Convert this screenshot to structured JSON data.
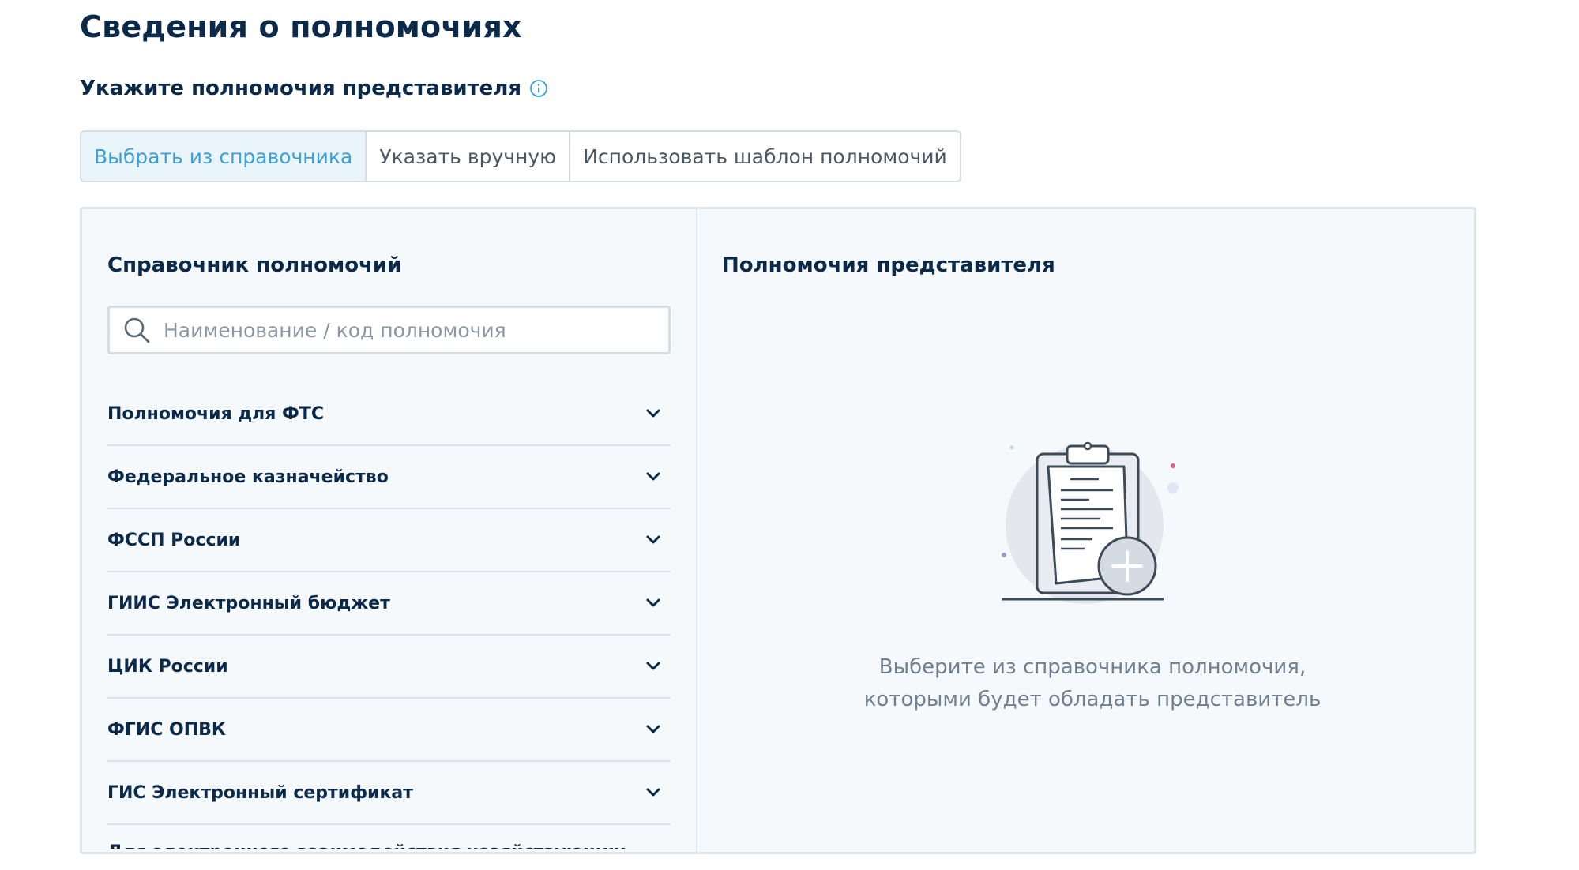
{
  "page": {
    "title": "Сведения о полномочиях",
    "subtitle": "Укажите полномочия представителя"
  },
  "tabs": [
    {
      "label": "Выбрать из справочника",
      "active": true
    },
    {
      "label": "Указать вручную",
      "active": false
    },
    {
      "label": "Использовать шаблон полномочий",
      "active": false
    }
  ],
  "directory": {
    "title": "Справочник полномочий",
    "search_placeholder": "Наименование / код полномочия",
    "search_value": "",
    "items": [
      {
        "label": "Полномочия для ФТС"
      },
      {
        "label": "Федеральное казначейство"
      },
      {
        "label": "ФССП России"
      },
      {
        "label": "ГИИС Электронный бюджет"
      },
      {
        "label": "ЦИК России"
      },
      {
        "label": "ФГИС ОПВК"
      },
      {
        "label": "ГИС Электронный сертификат"
      },
      {
        "label": "Для электронного взаимодействия хозяйствующих"
      }
    ]
  },
  "representative": {
    "title": "Полномочия представителя",
    "empty_line1": "Выберите из справочника полномочия,",
    "empty_line2": "которыми будет обладать представитель"
  },
  "colors": {
    "accent": "#3aa0d8",
    "text_dark": "#0b2a4a",
    "muted": "#6f8091",
    "panel_bg": "#f6f9fc",
    "border": "#dde5ec"
  },
  "icons": {
    "info": "info-icon",
    "search": "search-icon",
    "chevron": "chevron-down-icon",
    "empty": "clipboard-add-icon"
  }
}
